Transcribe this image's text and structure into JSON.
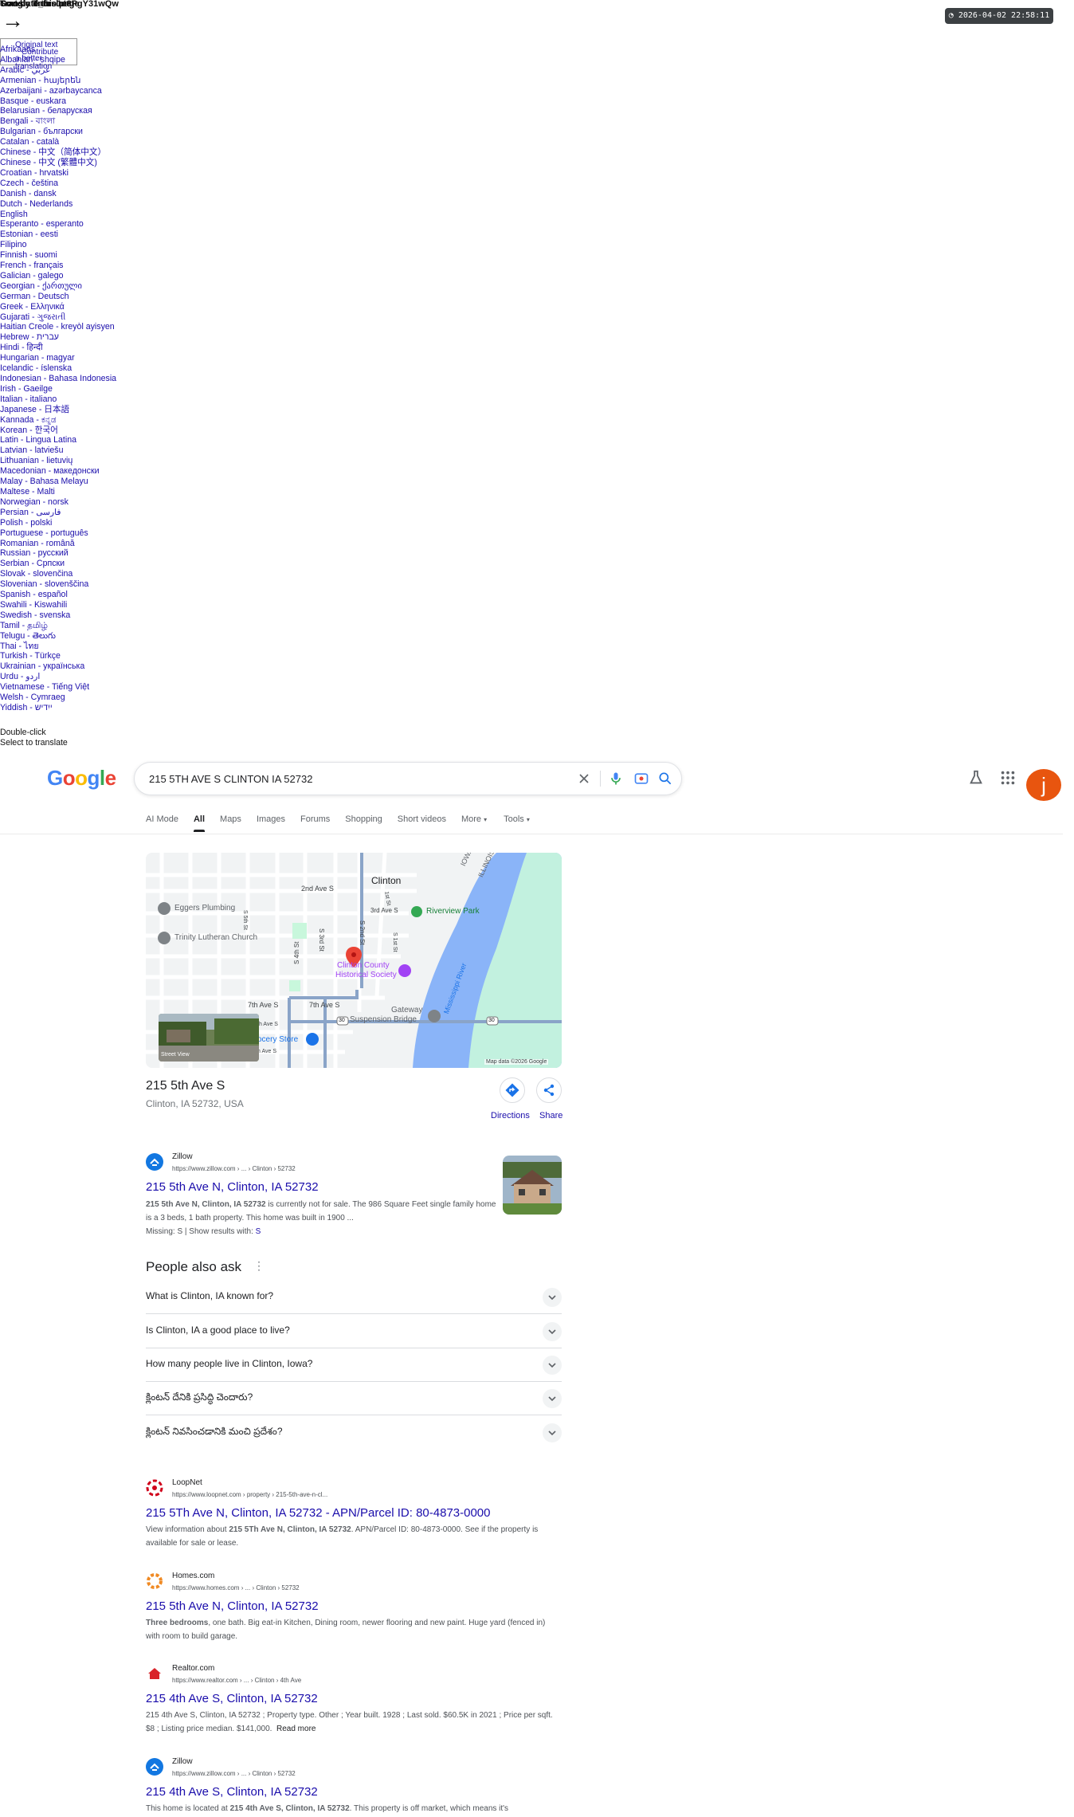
{
  "overlay": {
    "garbled_lines": [
      "Sort by date",
      "Translate this page",
      "Google Translate",
      "_5ro1e8PgY31wQw"
    ],
    "box_lines": [
      "Original text",
      "Contribute",
      "a better translation"
    ],
    "languages": [
      "Afrikaans",
      "Albanian - shqipe",
      "Arabic - عربي",
      "Armenian - հայերեն",
      "Azerbaijani - azərbaycanca",
      "Basque - euskara",
      "Belarusian - беларуская",
      "Bengali - বাংলা",
      "Bulgarian - български",
      "Catalan - català",
      "Chinese - 中文（简体中文）",
      "Chinese - 中文 (繁體中文)",
      "Croatian - hrvatski",
      "Czech - čeština",
      "Danish - dansk",
      "Dutch - Nederlands",
      "English",
      "Esperanto - esperanto",
      "Estonian - eesti",
      "Filipino",
      "Finnish - suomi",
      "French - français",
      "Galician - galego",
      "Georgian - ქართული",
      "German - Deutsch",
      "Greek - Ελληνικά",
      "Gujarati - ગુજરાતી",
      "Haitian Creole - kreyòl ayisyen",
      "Hebrew - עברית",
      "Hindi - हिन्दी",
      "Hungarian - magyar",
      "Icelandic - íslenska",
      "Indonesian - Bahasa Indonesia",
      "Irish - Gaeilge",
      "Italian - italiano",
      "Japanese - 日本語",
      "Kannada - ಕನ್ನಡ",
      "Korean - 한국어",
      "Latin - Lingua Latina",
      "Latvian - latviešu",
      "Lithuanian - lietuvių",
      "Macedonian - македонски",
      "Malay - Bahasa Melayu",
      "Maltese - Malti",
      "Norwegian - norsk",
      "Persian - فارسی",
      "Polish - polski",
      "Portuguese - português",
      "Romanian - română",
      "Russian - русский",
      "Serbian - Српски",
      "Slovak - slovenčina",
      "Slovenian - slovenščina",
      "Spanish - español",
      "Swahili - Kiswahili",
      "Swedish - svenska",
      "Tamil - தமிழ்",
      "Telugu - తెలుగు",
      "Thai - ไทย",
      "Turkish - Türkçe",
      "Ukrainian - українська",
      "Urdu - اردو",
      "Vietnamese - Tiếng Việt",
      "Welsh - Cymraeg",
      "Yiddish - ייִדיש"
    ],
    "hint_1": "Double-click",
    "hint_2": "Select to translate"
  },
  "clock": "2026-04-02 22:58:11",
  "header": {
    "query": "215 5TH AVE S CLINTON IA 52732",
    "avatar_letter": "j"
  },
  "tabs": [
    "AI Mode",
    "All",
    "Maps",
    "Images",
    "Forums",
    "Shopping",
    "Short videos",
    "More",
    "Tools"
  ],
  "map": {
    "city": "Clinton",
    "state_labels": [
      "IOWA",
      "ILLINOIS"
    ],
    "streets": [
      "2nd Ave S",
      "3rd Ave S",
      "7th Ave S",
      "7th Ave S",
      "S 5th St",
      "S 4th St",
      "S 3rd St",
      "S 2nd St",
      "S 1st St",
      "1st St",
      "Mississippi River",
      "th Ave S",
      "h Ave S"
    ],
    "pois": [
      "Eggers Plumbing",
      "Trinity Lutheran Church",
      "Riverview Park",
      "Clinton County",
      "Historical Society",
      "Gateway",
      "Suspension Bridge",
      "ocery Store"
    ],
    "routes": [
      "30",
      "30"
    ],
    "attribution": "Map data ©2026 Google",
    "street_view": "Street View"
  },
  "place": {
    "title": "215 5th Ave S",
    "address": "Clinton, IA 52732, USA",
    "directions": "Directions",
    "share": "Share"
  },
  "results": [
    {
      "source": "Zillow",
      "url": "https://www.zillow.com › ... › Clinton › 52732",
      "title": "215 5th Ave N, Clinton, IA 52732",
      "snippet_bold": "215 5th Ave N, Clinton, IA 52732",
      "snippet": " is currently not for sale. The 986 Square Feet single family home is a 3 beds, 1 bath property. This home was built in 1900 ...",
      "missing": "Missing: S | Show results with: ",
      "missing_link": "S"
    },
    {
      "source": "LoopNet",
      "url": "https://www.loopnet.com › property › 215-5th-ave-n-cl...",
      "title": "215 5Th Ave N, Clinton, IA 52732 - APN/Parcel ID: 80-4873-0000",
      "snippet_pre": "View information about ",
      "snippet_bold": "215 5Th Ave N, Clinton, IA 52732",
      "snippet": ". APN/Parcel ID: 80-4873-0000. See if the property is available for sale or lease."
    },
    {
      "source": "Homes.com",
      "url": "https://www.homes.com › ... › Clinton › 52732",
      "title": "215 5th Ave N, Clinton, IA 52732",
      "snippet_bold": "Three bedrooms",
      "snippet": ", one bath. Big eat-in Kitchen, Dining room, newer flooring and new paint. Huge yard (fenced in) with room to build garage."
    },
    {
      "source": "Realtor.com",
      "url": "https://www.realtor.com › ... › Clinton › 4th Ave",
      "title": "215 4th Ave S, Clinton, IA 52732",
      "snippet_bold": "215 4th Ave S, Clinton, IA 52732",
      "snippet": " ; Property type. Other ; Year built. 1928 ; Last sold. $60.5K in 2021 ; Price per sqft. $8 ; Listing price median. $141,000.",
      "more": "Read more"
    },
    {
      "source": "Zillow",
      "url": "https://www.zillow.com › ... › Clinton › 52732",
      "title": "215 4th Ave S, Clinton, IA 52732",
      "snippet_pre": "This home is located at ",
      "snippet_bold": "215 4th Ave S, Clinton, IA 52732",
      "snippet": ". This property is off market, which means it's"
    }
  ],
  "paa": {
    "title": "People also ask",
    "questions": [
      "What is Clinton, IA known for?",
      "Is Clinton, IA a good place to live?",
      "How many people live in Clinton, Iowa?",
      "క్లింటన్ దేనికి ప్రసిద్ధి చెందారు?",
      "క్లింటన్ నివసించడానికి మంచి ప్రదేశం?"
    ]
  },
  "colors": {
    "link": "#1a0dab",
    "avatar": "#e8550f",
    "water": "#8ab4f8",
    "park": "#c8f7dc"
  }
}
